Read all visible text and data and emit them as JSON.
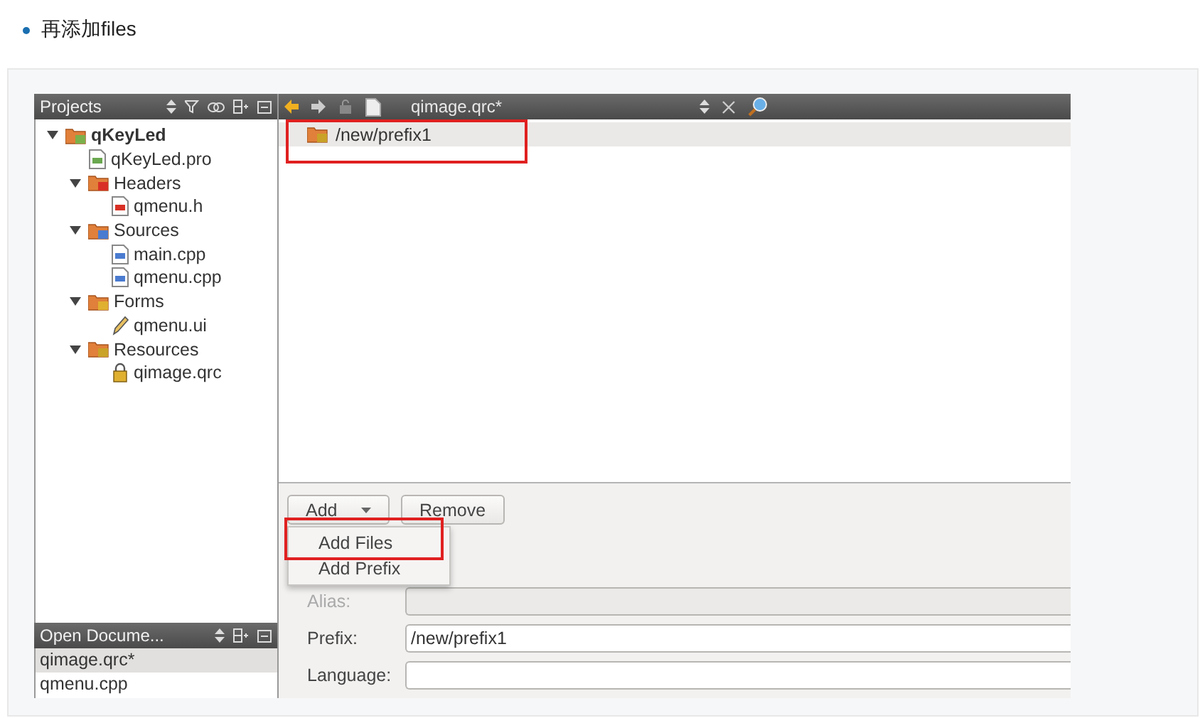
{
  "bullet": {
    "text": "再添加files"
  },
  "projects_pane": {
    "title": "Projects",
    "tree": [
      {
        "label": "qKeyLed",
        "kind": "project",
        "expanded": true,
        "children": [
          {
            "label": "qKeyLed.pro",
            "kind": "pro"
          },
          {
            "label": "Headers",
            "kind": "headers",
            "expanded": true,
            "children": [
              {
                "label": "qmenu.h",
                "kind": "header"
              }
            ]
          },
          {
            "label": "Sources",
            "kind": "sources",
            "expanded": true,
            "children": [
              {
                "label": "main.cpp",
                "kind": "cpp"
              },
              {
                "label": "qmenu.cpp",
                "kind": "cpp"
              }
            ]
          },
          {
            "label": "Forms",
            "kind": "forms",
            "expanded": true,
            "children": [
              {
                "label": "qmenu.ui",
                "kind": "ui"
              }
            ]
          },
          {
            "label": "Resources",
            "kind": "resources",
            "expanded": true,
            "children": [
              {
                "label": "qimage.qrc",
                "kind": "qrc"
              }
            ]
          }
        ]
      }
    ]
  },
  "open_documents": {
    "title": "Open Docume...",
    "items": [
      {
        "label": "qimage.qrc*",
        "selected": true
      },
      {
        "label": "qmenu.cpp",
        "selected": false
      }
    ]
  },
  "editor": {
    "file": "qimage.qrc*",
    "prefixes": [
      {
        "label": "/new/prefix1",
        "selected": true,
        "highlighted": true
      }
    ],
    "buttons": [
      {
        "label": "Add",
        "kind": "dropdown"
      },
      {
        "label": "Remove",
        "kind": "push"
      }
    ],
    "add_menu": [
      {
        "label": "Add Files",
        "highlighted": true
      },
      {
        "label": "Add Prefix",
        "highlighted": false
      }
    ],
    "fields": [
      {
        "label": "Alias:",
        "disabled": true
      },
      {
        "label": "Prefix:",
        "value": "/new/prefix1",
        "disabled": false
      },
      {
        "label": "Language:",
        "disabled": false
      }
    ]
  }
}
